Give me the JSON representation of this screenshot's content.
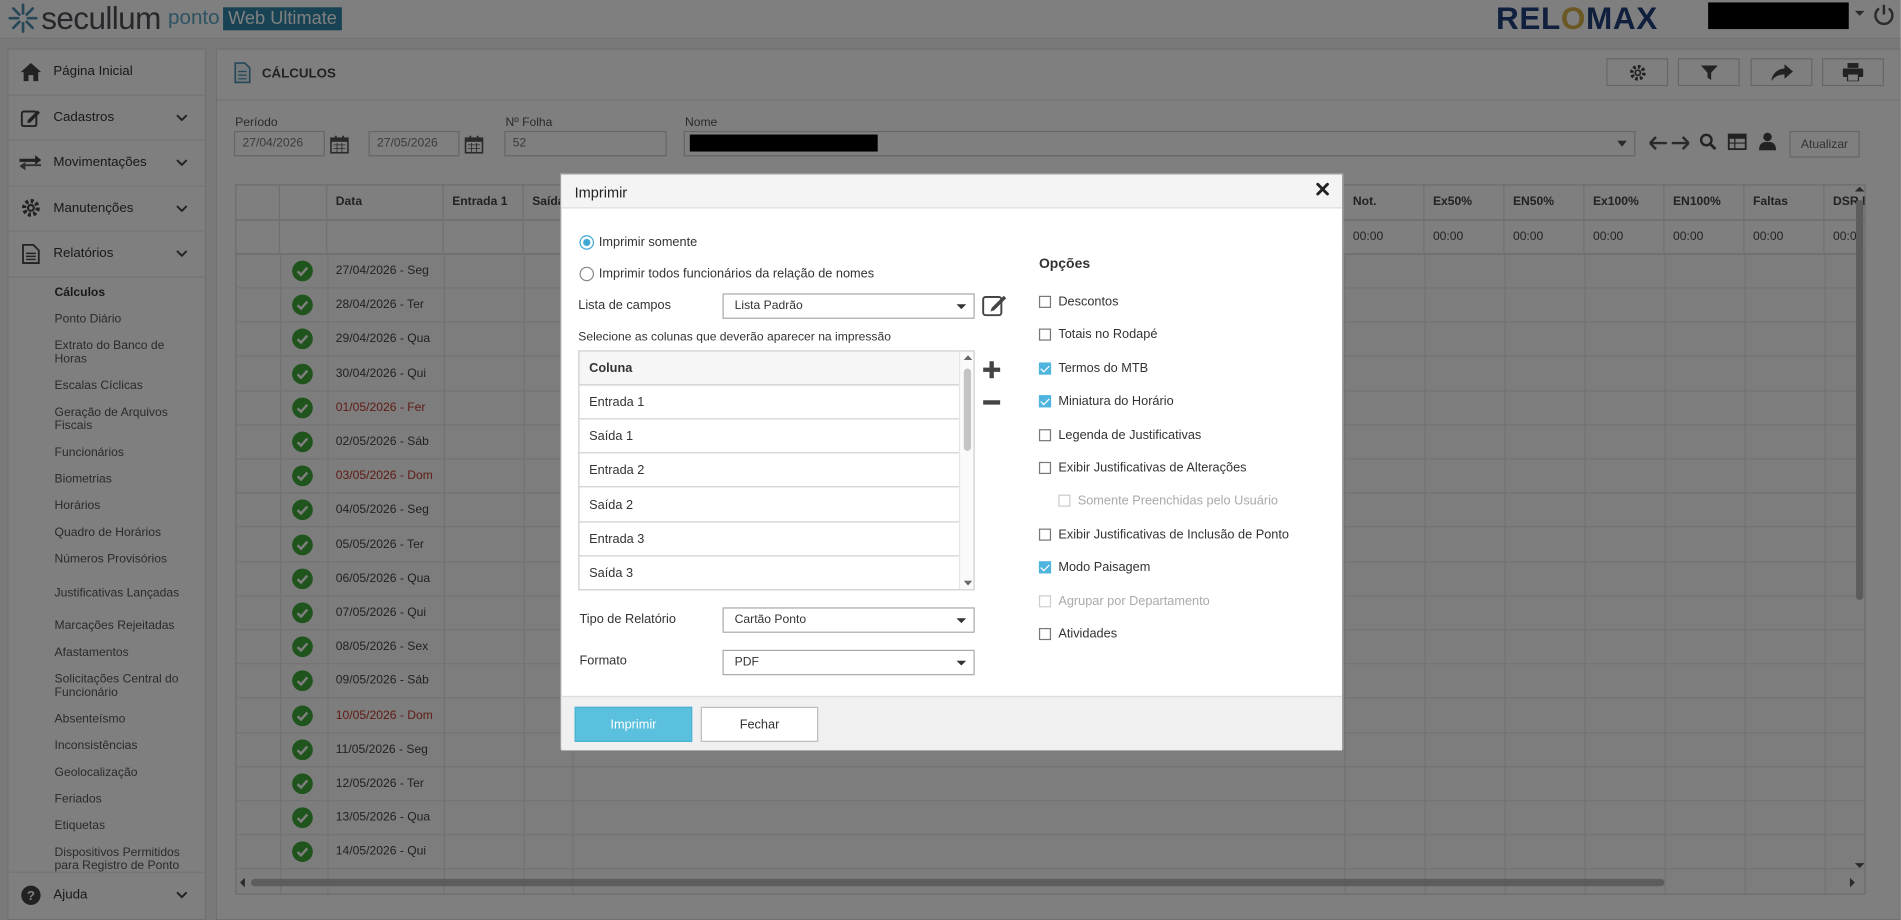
{
  "app": {
    "logo_text": "secullum",
    "logo_sub": "ponto",
    "logo_web": "Web Ultimate",
    "client_logo_left": "REL",
    "client_logo_o": "O",
    "client_logo_right": "MAX"
  },
  "sidebar": {
    "main_items": [
      {
        "label": "Página Inicial",
        "icon": "home-icon"
      },
      {
        "label": "Cadastros",
        "icon": "edit-icon"
      },
      {
        "label": "Movimentações",
        "icon": "transfer-icon"
      },
      {
        "label": "Manutenções",
        "icon": "gear-icon"
      },
      {
        "label": "Relatórios",
        "icon": "report-icon"
      }
    ],
    "sub_items": [
      "Cálculos",
      "Ponto Diário",
      "Extrato do Banco de Horas",
      "Escalas Cíclicas",
      "Geração de Arquivos Fiscais",
      "Funcionários",
      "Biometrias",
      "Horários",
      "Quadro de Horários",
      "Números Provisórios",
      "Justificativas Lançadas",
      "Marcações Rejeitadas",
      "Afastamentos",
      "Solicitações Central do Funcionário",
      "Absenteísmo",
      "Inconsistências",
      "Geolocalização",
      "Feriados",
      "Etiquetas",
      "Dispositivos Permitidos para Registro de Ponto"
    ],
    "help_label": "Ajuda"
  },
  "page": {
    "title": "CÁLCULOS",
    "periodo_label": "Período",
    "date_from": "27/04/2026",
    "date_to": "27/05/2026",
    "folha_label": "Nº Folha",
    "folha_value": "52",
    "nome_label": "Nome",
    "update_button": "Atualizar"
  },
  "grid": {
    "headers": [
      "Data",
      "Entrada 1",
      "Saída",
      "Not.",
      "Ex50%",
      "EN50%",
      "Ex100%",
      "EN100%",
      "Faltas",
      "DSR.D"
    ],
    "totals": [
      "00:00",
      "00:00",
      "00:00",
      "00:00",
      "00:00",
      "00:00",
      "00:00"
    ],
    "rows": [
      {
        "date": "27/04/2026 - Seg",
        "holiday": false
      },
      {
        "date": "28/04/2026 - Ter",
        "holiday": false
      },
      {
        "date": "29/04/2026 - Qua",
        "holiday": false
      },
      {
        "date": "30/04/2026 - Qui",
        "holiday": false
      },
      {
        "date": "01/05/2026 - Fer",
        "holiday": true
      },
      {
        "date": "02/05/2026 - Sáb",
        "holiday": false
      },
      {
        "date": "03/05/2026 - Dom",
        "holiday": true
      },
      {
        "date": "04/05/2026 - Seg",
        "holiday": false
      },
      {
        "date": "05/05/2026 - Ter",
        "holiday": false
      },
      {
        "date": "06/05/2026 - Qua",
        "holiday": false
      },
      {
        "date": "07/05/2026 - Qui",
        "holiday": false
      },
      {
        "date": "08/05/2026 - Sex",
        "holiday": false
      },
      {
        "date": "09/05/2026 - Sáb",
        "holiday": false
      },
      {
        "date": "10/05/2026 - Dom",
        "holiday": true
      },
      {
        "date": "11/05/2026 - Seg",
        "holiday": false
      },
      {
        "date": "12/05/2026 - Ter",
        "holiday": false
      },
      {
        "date": "13/05/2026 - Qua",
        "holiday": false
      },
      {
        "date": "14/05/2026 - Qui",
        "holiday": false
      }
    ]
  },
  "modal": {
    "title": "Imprimir",
    "radio_only": "Imprimir somente",
    "radio_all": "Imprimir todos funcionários da relação de nomes",
    "campos_label": "Lista de campos",
    "campos_value": "Lista Padrão",
    "columns_label": "Selecione as colunas que deverão aparecer na impressão",
    "column_header": "Coluna",
    "columns": [
      "Entrada 1",
      "Saída 1",
      "Entrada 2",
      "Saída 2",
      "Entrada 3",
      "Saída 3"
    ],
    "tipo_label": "Tipo de Relatório",
    "tipo_value": "Cartão Ponto",
    "formato_label": "Formato",
    "formato_value": "PDF",
    "options_title": "Opções",
    "options": [
      {
        "label": "Descontos",
        "checked": false,
        "disabled": false,
        "indent": false
      },
      {
        "label": "Totais no Rodapé",
        "checked": false,
        "disabled": false,
        "indent": false
      },
      {
        "label": "Termos do MTB",
        "checked": true,
        "disabled": false,
        "indent": false
      },
      {
        "label": "Miniatura do Horário",
        "checked": true,
        "disabled": false,
        "indent": false
      },
      {
        "label": "Legenda de Justificativas",
        "checked": false,
        "disabled": false,
        "indent": false
      },
      {
        "label": "Exibir Justificativas de Alterações",
        "checked": false,
        "disabled": false,
        "indent": false
      },
      {
        "label": "Somente Preenchidas pelo Usuário",
        "checked": false,
        "disabled": true,
        "indent": true
      },
      {
        "label": "Exibir Justificativas de Inclusão de Ponto",
        "checked": false,
        "disabled": false,
        "indent": false
      },
      {
        "label": "Modo Paisagem",
        "checked": true,
        "disabled": false,
        "indent": false
      },
      {
        "label": "Agrupar por Departamento",
        "checked": false,
        "disabled": true,
        "indent": false
      },
      {
        "label": "Atividades",
        "checked": false,
        "disabled": false,
        "indent": false
      }
    ],
    "print_button": "Imprimir",
    "close_button": "Fechar"
  },
  "colors": {
    "accent": "#5bc0de",
    "check_green": "#3ea83a",
    "holiday_red": "#c0392b",
    "brand_blue": "#2e87aa"
  }
}
